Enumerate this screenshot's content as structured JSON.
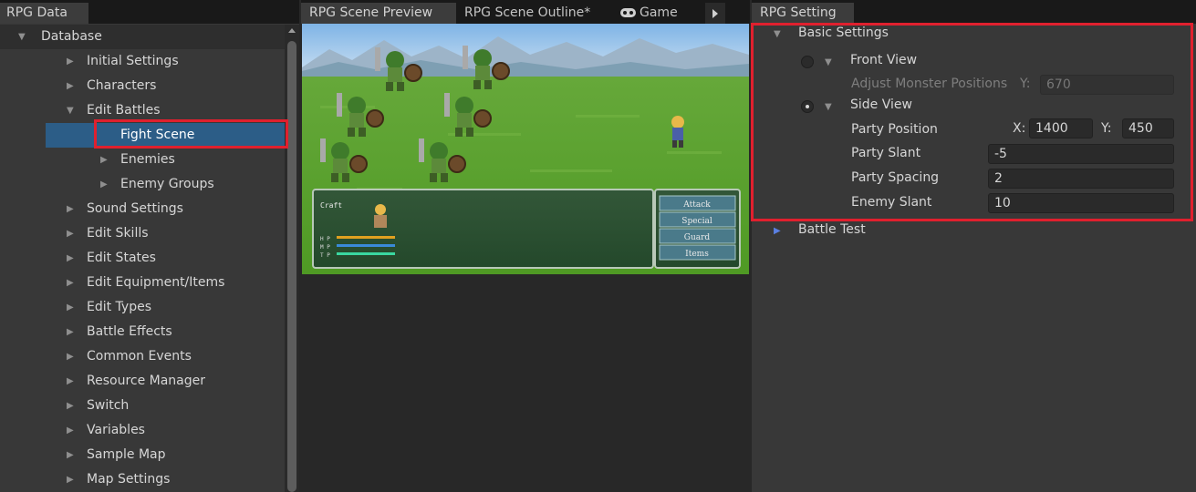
{
  "left_panel": {
    "tab": "RPG Data",
    "tree": [
      {
        "label": "Database",
        "level": 0,
        "expanded": true
      },
      {
        "label": "Initial Settings",
        "level": 1
      },
      {
        "label": "Characters",
        "level": 1
      },
      {
        "label": "Edit Battles",
        "level": 1,
        "expanded": true
      },
      {
        "label": "Fight Scene",
        "level": 2,
        "selected": true
      },
      {
        "label": "Enemies",
        "level": 2
      },
      {
        "label": "Enemy Groups",
        "level": 2
      },
      {
        "label": "Sound Settings",
        "level": 1
      },
      {
        "label": "Edit Skills",
        "level": 1
      },
      {
        "label": "Edit States",
        "level": 1
      },
      {
        "label": "Edit Equipment/Items",
        "level": 1
      },
      {
        "label": "Edit Types",
        "level": 1
      },
      {
        "label": "Battle Effects",
        "level": 1
      },
      {
        "label": "Common Events",
        "level": 1
      },
      {
        "label": "Resource Manager",
        "level": 1
      },
      {
        "label": "Switch",
        "level": 1
      },
      {
        "label": "Variables",
        "level": 1
      },
      {
        "label": "Sample Map",
        "level": 1
      },
      {
        "label": "Map Settings",
        "level": 1
      }
    ]
  },
  "middle_panel": {
    "tabs": [
      "RPG Scene Preview",
      "RPG Scene Outline*",
      "Game"
    ],
    "active_tab": "RPG Scene Preview",
    "preview": {
      "actor_name": "Craft",
      "gauges": [
        "H P",
        "M P",
        "T P"
      ],
      "commands": [
        "Attack",
        "Special",
        "Guard",
        "Items"
      ]
    }
  },
  "right_panel": {
    "tab": "RPG Setting",
    "basic_settings": {
      "title": "Basic Settings",
      "front_view": {
        "label": "Front View",
        "selected": false,
        "adjust_label": "Adjust Monster Positions",
        "y_label": "Y:",
        "y_value": "670"
      },
      "side_view": {
        "label": "Side View",
        "selected": true,
        "party_position_label": "Party Position",
        "x_label": "X:",
        "x_value": "1400",
        "y_label": "Y:",
        "y_value": "450",
        "party_slant_label": "Party Slant",
        "party_slant_value": "-5",
        "party_spacing_label": "Party Spacing",
        "party_spacing_value": "2",
        "enemy_slant_label": "Enemy Slant",
        "enemy_slant_value": "10"
      }
    },
    "battle_test": {
      "title": "Battle Test"
    }
  },
  "colors": {
    "selection": "#2c5d87",
    "highlight": "#e0202e",
    "foldout_accent": "#5a7fe0"
  }
}
